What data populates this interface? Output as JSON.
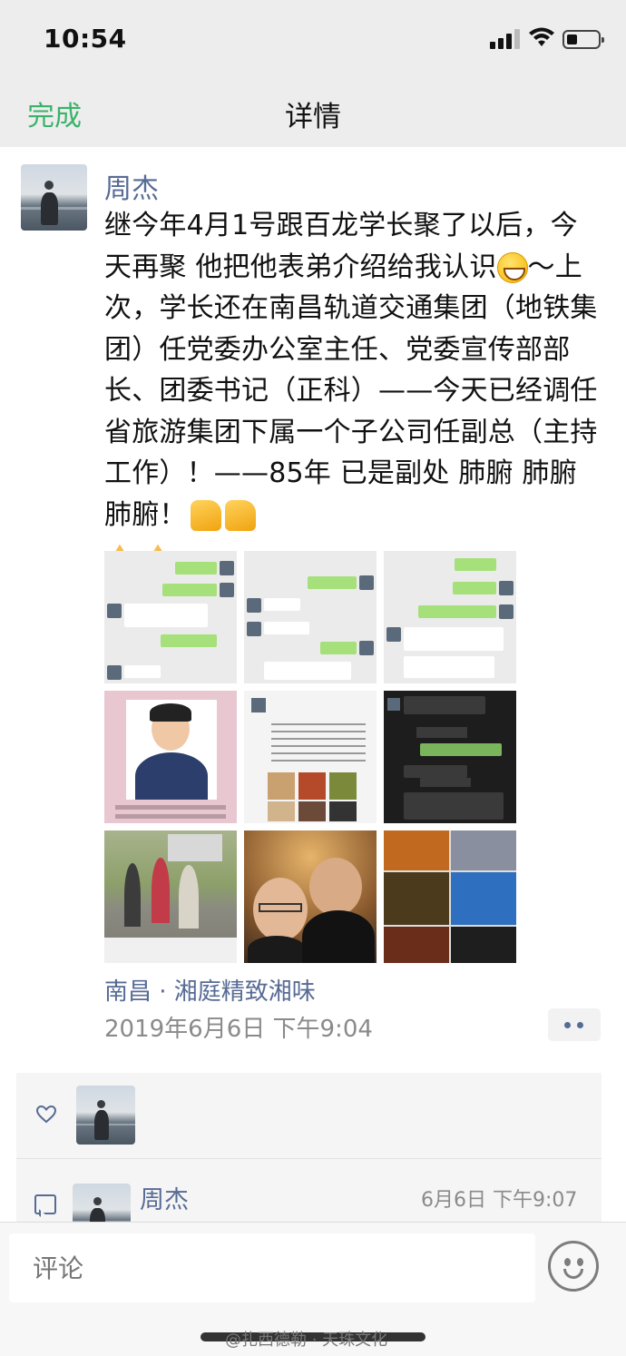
{
  "status_bar": {
    "time": "10:54"
  },
  "nav": {
    "left_label": "完成",
    "title": "详情"
  },
  "post": {
    "author": "周杰",
    "text_parts": [
      "继今年4月1号跟百龙学长聚了以后，今天再聚 他把他表弟介绍给我认识",
      "～上次，学长还在南昌轨道交通集团（地铁集团）任党委办公室主任、党委宣传部部长、团委书记（正科）——今天已经调任省旅游集团下属一个子公司任副总（主持工作）！——85年 已是副处 肺腑 肺腑 肺腑！"
    ],
    "emojis": [
      "grin-emoji",
      "thumbs-up-emoji",
      "thumbs-up-emoji",
      "pray-emoji",
      "pray-emoji"
    ],
    "images": [
      "chat-screenshot-1",
      "chat-screenshot-2",
      "chat-screenshot-3",
      "id-photo",
      "chat-screenshot-4",
      "chat-screenshot-dark",
      "outdoor-group-photo",
      "selfie-photo",
      "food-photo"
    ],
    "location": "南昌 · 湘庭精致湘味",
    "time": "2019年6月6日 下午9:04"
  },
  "interactions": {
    "comment": {
      "author": "周杰",
      "time": "6月6日 下午9:07"
    }
  },
  "input": {
    "placeholder": "评论"
  },
  "watermark": "@扎西德勒 · 天珠文化"
}
